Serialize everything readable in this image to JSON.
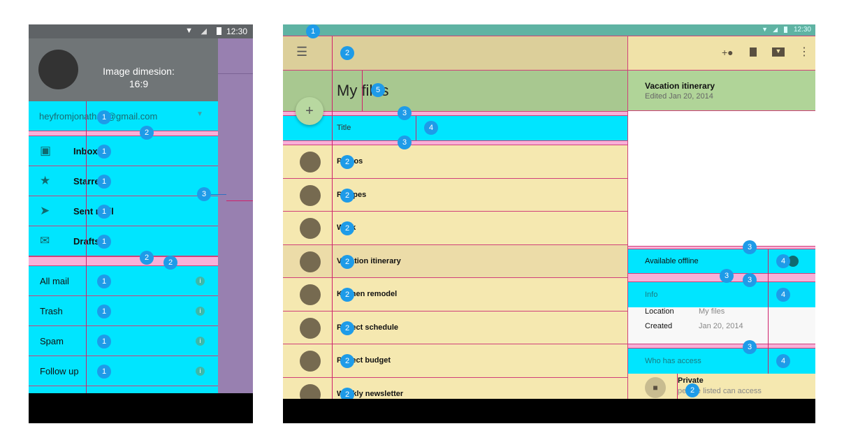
{
  "status_bar": {
    "time": "12:30"
  },
  "phone": {
    "header_text": "Image dimesion:",
    "header_ratio": "16:9",
    "account_email": "heyfromjonathan@gmail.com",
    "primary_items": [
      {
        "label": "Inbox",
        "icon": "inbox-icon"
      },
      {
        "label": "Starred",
        "icon": "star-icon"
      },
      {
        "label": "Sent mail",
        "icon": "send-icon"
      },
      {
        "label": "Drafts",
        "icon": "drafts-icon"
      }
    ],
    "secondary_items": [
      {
        "label": "All mail"
      },
      {
        "label": "Trash"
      },
      {
        "label": "Spam"
      },
      {
        "label": "Follow up"
      }
    ],
    "info_glyph": "i"
  },
  "tablet": {
    "title": "My files",
    "fab_glyph": "+",
    "column_header": "Title",
    "files": [
      "Photos",
      "Recipes",
      "Work",
      "Vacation itinerary",
      "Kitchen remodel",
      "Project schedule",
      "Project budget",
      "Weekly newsletter"
    ],
    "detail": {
      "title": "Vacation itinerary",
      "subtitle": "Edited Jan 20, 2014",
      "offline_label": "Available offline",
      "info_label": "Info",
      "location_label": "Location",
      "location_value": "My files",
      "created_label": "Created",
      "created_value": "Jan 20, 2014",
      "access_label": "Who has access",
      "access_title": "Private",
      "access_sub": "people listed can access"
    },
    "toolbar_icons": [
      "add-person-icon",
      "delete-icon",
      "move-to-folder-icon",
      "more-vert-icon"
    ]
  },
  "annotations": {
    "one": "1",
    "two": "2",
    "three": "3",
    "four": "4",
    "five": "5"
  },
  "colors": {
    "keyline": "#d0206a",
    "cyan": "#00e5ff",
    "pink": "#f8b0d8",
    "badge": "#1e9be8"
  }
}
